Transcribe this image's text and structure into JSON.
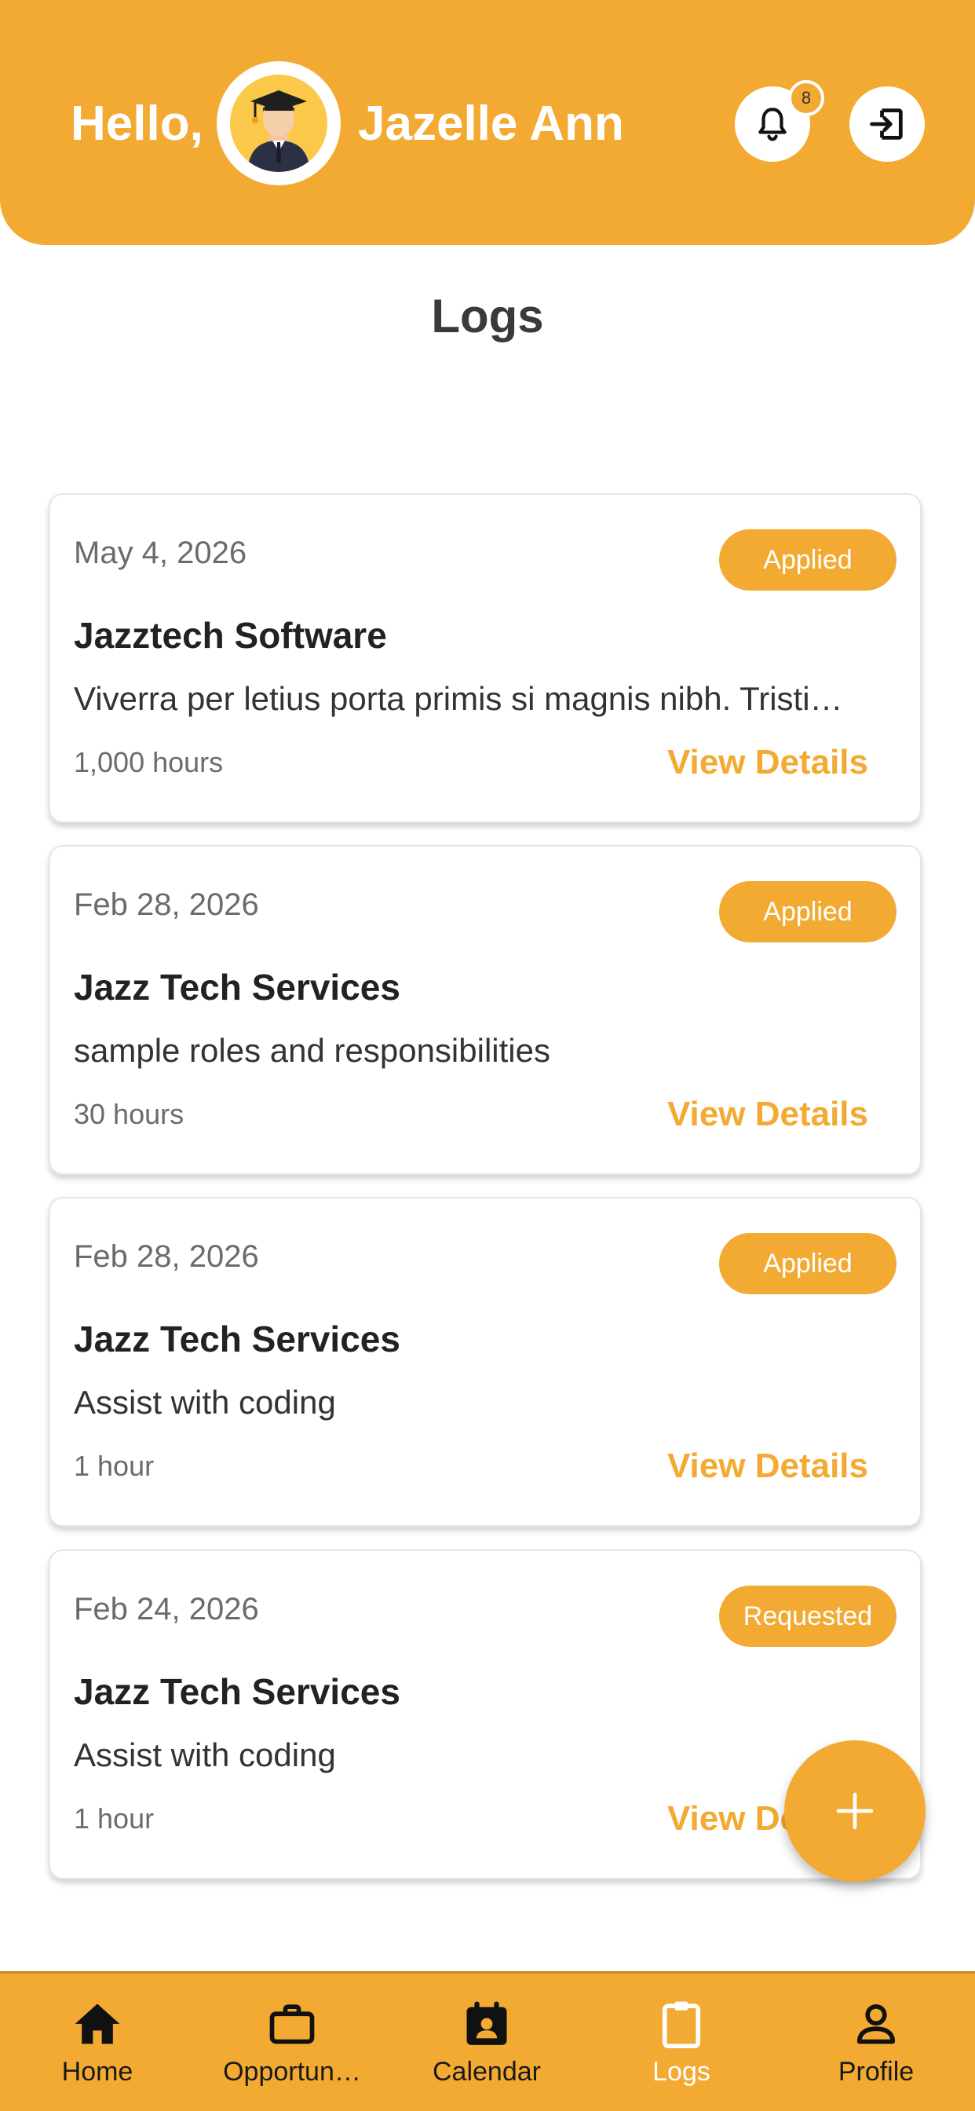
{
  "header": {
    "greeting": "Hello,",
    "user_name": "Jazelle Ann",
    "notification_count": "8",
    "accent_color": "#F3AA32"
  },
  "page": {
    "title": "Logs"
  },
  "logs": [
    {
      "date": "May 4, 2026",
      "status": "Applied",
      "company": "Jazztech Software",
      "description": "Viverra per letius porta primis si magnis nibh. Tristi…",
      "hours": "1,000 hours",
      "action": "View Details"
    },
    {
      "date": "Feb 28, 2026",
      "status": "Applied",
      "company": "Jazz Tech Services",
      "description": "sample roles and responsibilities",
      "hours": "30 hours",
      "action": "View Details"
    },
    {
      "date": "Feb 28, 2026",
      "status": "Applied",
      "company": "Jazz Tech Services",
      "description": "Assist with coding",
      "hours": "1 hour",
      "action": "View Details"
    },
    {
      "date": "Feb 24, 2026",
      "status": "Requested",
      "company": "Jazz Tech Services",
      "description": "Assist with coding",
      "hours": "1 hour",
      "action": "View Details"
    }
  ],
  "fab": {
    "icon": "plus-icon"
  },
  "nav": {
    "items": [
      {
        "label": "Home",
        "icon": "home-icon"
      },
      {
        "label": "Opportun…",
        "icon": "briefcase-icon"
      },
      {
        "label": "Calendar",
        "icon": "calendar-icon"
      },
      {
        "label": "Logs",
        "icon": "clipboard-icon",
        "active": true
      },
      {
        "label": "Profile",
        "icon": "person-icon"
      }
    ]
  }
}
